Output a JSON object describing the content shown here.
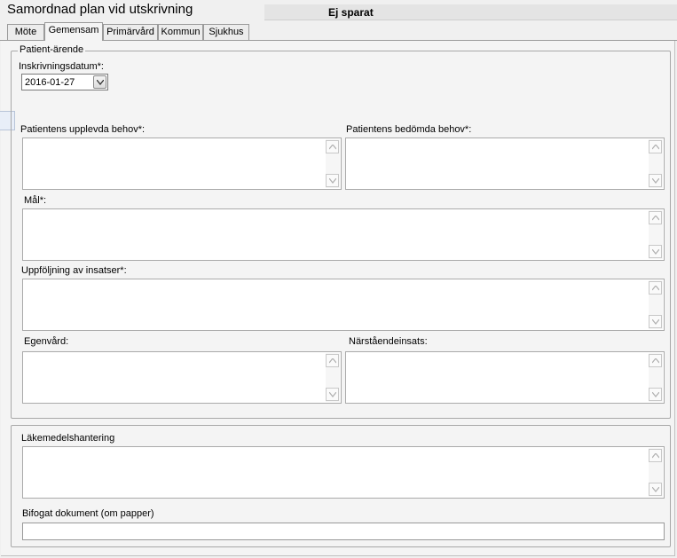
{
  "window": {
    "title": "Samordnad plan vid utskrivning",
    "status": "Ej sparat"
  },
  "tabs": [
    {
      "label": "Möte",
      "active": false
    },
    {
      "label": "Gemensam",
      "active": true
    },
    {
      "label": "Primärvård",
      "active": false
    },
    {
      "label": "Kommun",
      "active": false
    },
    {
      "label": "Sjukhus",
      "active": false
    }
  ],
  "patient_group": {
    "legend": "Patient-ärende",
    "admission_date_label": "Inskrivningsdatum*:",
    "admission_date_value": "2016-01-27",
    "fields": {
      "perceived_needs_label": "Patientens upplevda behov*:",
      "assessed_needs_label": "Patientens bedömda behov*:",
      "goal_label": "Mål*:",
      "followup_label": "Uppföljning av insatser*:",
      "selfcare_label": "Egenvård:",
      "relative_label": "Närståendeinsats:"
    }
  },
  "medication_group": {
    "legend": "Läkemedelshantering",
    "attached_doc_label": "Bifogat dokument (om papper)"
  },
  "icons": {
    "scroll_up": "chevron-up-icon",
    "scroll_down": "chevron-down-icon",
    "dropdown": "chevron-down-icon"
  }
}
